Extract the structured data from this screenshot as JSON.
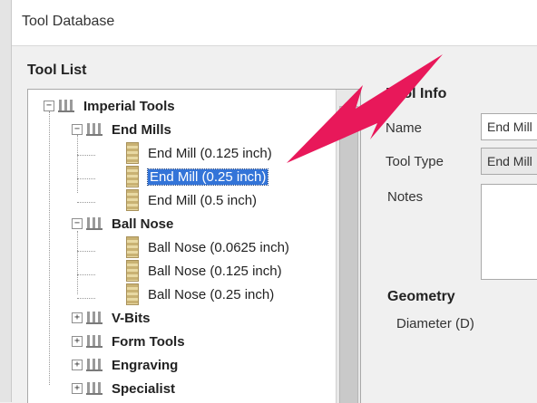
{
  "window": {
    "title": "Tool Database"
  },
  "tool_list": {
    "heading": "Tool List",
    "root": {
      "label": "Imperial Tools",
      "expander": "−"
    },
    "groups": [
      {
        "label": "End Mills",
        "expander": "−",
        "items": [
          "End Mill (0.125 inch)",
          "End Mill (0.25 inch)",
          "End Mill (0.5 inch)"
        ],
        "selected_index": 1
      },
      {
        "label": "Ball Nose",
        "expander": "−",
        "items": [
          "Ball Nose (0.0625 inch)",
          "Ball Nose (0.125 inch)",
          "Ball Nose (0.25 inch)"
        ]
      },
      {
        "label": "V-Bits",
        "expander": "+"
      },
      {
        "label": "Form Tools",
        "expander": "+"
      },
      {
        "label": "Engraving",
        "expander": "+"
      },
      {
        "label": "Specialist",
        "expander": "+"
      }
    ]
  },
  "tool_info": {
    "heading": "Tool Info",
    "name_label": "Name",
    "name_value": "End Mill",
    "tool_type_label": "Tool Type",
    "tool_type_value": "End Mill",
    "notes_label": "Notes"
  },
  "geometry": {
    "heading": "Geometry",
    "diameter_label": "Diameter (D)"
  },
  "annotation": {
    "arrow_color": "#e8185a"
  },
  "icons": {
    "folder": "tool-folder-icon",
    "tool": "end-mill-icon"
  }
}
